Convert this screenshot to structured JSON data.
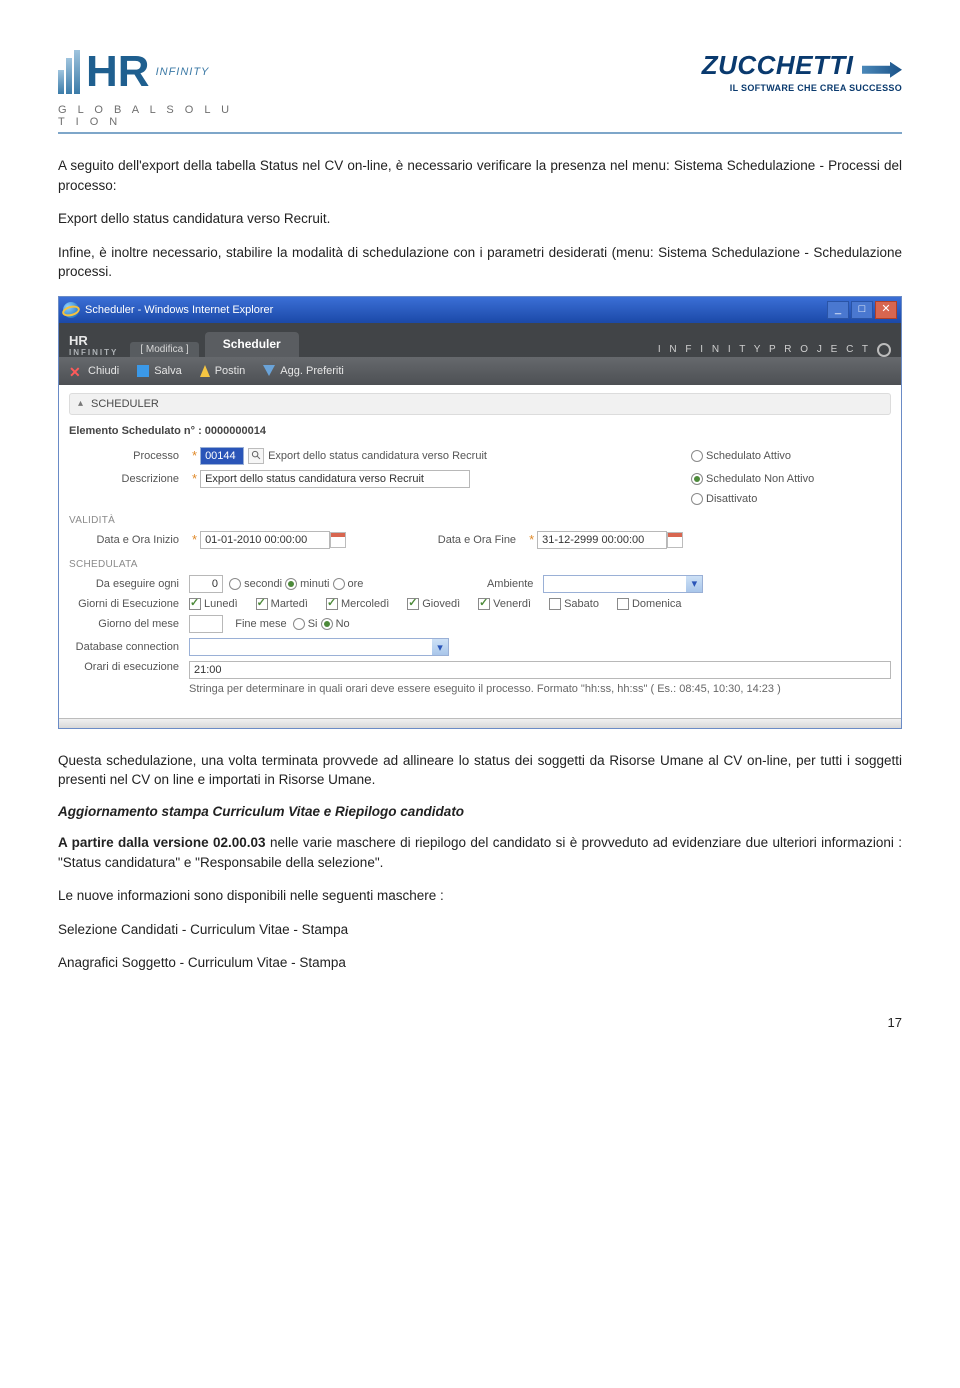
{
  "header": {
    "hr_text": "HR",
    "hr_sub": "INFINITY",
    "hr_tag": "G L O B A L   S O L U T I O N",
    "z_name": "ZUCCHETTI",
    "z_tag": "IL SOFTWARE CHE CREA SUCCESSO"
  },
  "para1": "A seguito dell'export della tabella Status nel CV on-line, è necessario verificare la presenza nel menu: Sistema Schedulazione - Processi del processo:",
  "para2": "Export dello status candidatura verso Recruit.",
  "para3": "Infine, è inoltre necessario,  stabilire la modalità di schedulazione con i parametri desiderati (menu: Sistema Schedulazione - Schedulazione processi.",
  "shot": {
    "title": "Scheduler - Windows Internet Explorer",
    "app_logo": "HR",
    "app_logo_sub": "INFINITY",
    "tab_mod": "[ Modifica ]",
    "tab_active": "Scheduler",
    "project": "I N F I N I T Y      P R O J E C T",
    "toolbar": {
      "close": "Chiudi",
      "save": "Salva",
      "postin": "Postin",
      "fav": "Agg. Preferiti"
    },
    "section": "SCHEDULER",
    "elem_label": "Elemento Schedulato n° : 0000000014",
    "processo_lbl": "Processo",
    "processo_val": "00144",
    "processo_desc": "Export dello status candidatura verso Recruit",
    "descr_lbl": "Descrizione",
    "descr_val": "Export dello status candidatura verso Recruit",
    "r1": "Schedulato Attivo",
    "r2": "Schedulato Non Attivo",
    "r3": "Disattivato",
    "validita": "VALIDITÀ",
    "dstart_lbl": "Data e Ora Inizio",
    "dstart_val": "01-01-2010 00:00:00",
    "dend_lbl": "Data e Ora Fine",
    "dend_val": "31-12-2999 00:00:00",
    "schedulata": "SCHEDULATA",
    "every_lbl": "Da eseguire ogni",
    "every_val": "0",
    "unit_sec": "secondi",
    "unit_min": "minuti",
    "unit_ore": "ore",
    "amb_lbl": "Ambiente",
    "days_lbl": "Giorni di Esecuzione",
    "days": [
      "Lunedì",
      "Martedì",
      "Mercoledì",
      "Giovedì",
      "Venerdì",
      "Sabato",
      "Domenica"
    ],
    "gmese_lbl": "Giorno del mese",
    "fmese_lbl": "Fine mese",
    "si": "Si",
    "no": "No",
    "db_lbl": "Database connection",
    "orari_lbl": "Orari di esecuzione",
    "orari_val": "21:00",
    "hint": "Stringa per determinare in quali orari deve essere eseguito il processo. Formato \"hh:ss, hh:ss\" ( Es.: 08:45, 10:30, 14:23 )"
  },
  "para4": "Questa schedulazione, una volta terminata provvede ad allineare lo status dei soggetti da Risorse Umane al CV on-line, per tutti i soggetti presenti nel CV on line e importati in Risorse Umane.",
  "sec_title": "Aggiornamento stampa Curriculum Vitae e Riepilogo candidato",
  "para5a": "A partire dalla versione 02.00.03",
  "para5b": " nelle varie maschere di riepilogo del candidato si è provveduto ad evidenziare  due ulteriori informazioni : \"Status candidatura\" e \"Responsabile della selezione\".",
  "para6": "Le nuove informazioni sono disponibili nelle seguenti maschere :",
  "para7": "Selezione Candidati - Curriculum Vitae - Stampa",
  "para8": "Anagrafici Soggetto - Curriculum Vitae - Stampa",
  "page_number": "17"
}
